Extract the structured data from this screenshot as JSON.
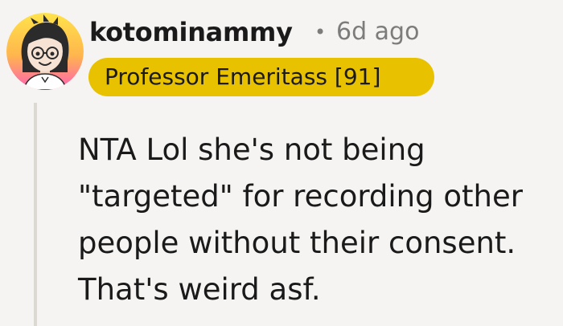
{
  "comment": {
    "author": {
      "username": "kotominammy",
      "avatar_icon": "cartoon-girl-with-glasses-avatar-icon"
    },
    "separator": "•",
    "age": "6d ago",
    "flair": {
      "text": "Professor Emeritass [91]",
      "color": "#e8c101"
    },
    "body_lines": [
      "NTA Lol she's not being",
      "\"targeted\" for recording other",
      "people without their consent.",
      "That's weird asf."
    ]
  }
}
